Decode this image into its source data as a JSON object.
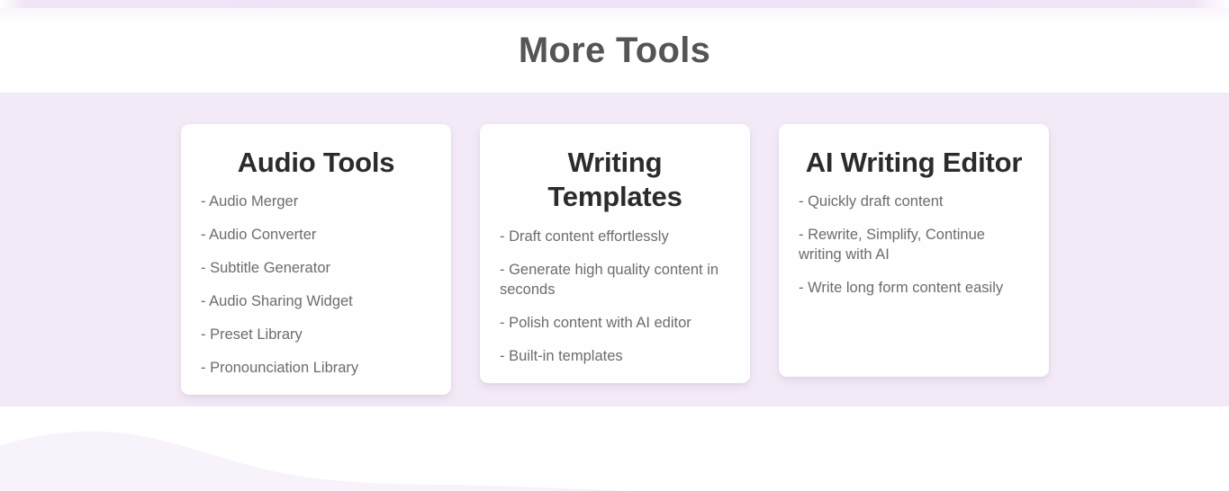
{
  "section": {
    "title": "More Tools"
  },
  "colors": {
    "band_background": "#f3eaf7",
    "card_background": "#fefefe",
    "page_title": "#555558",
    "card_title": "#2b2b2e",
    "list_text": "#6c6c72",
    "top_strip": "#efe2f6",
    "wave": "#f8f2fb"
  },
  "cards": [
    {
      "title": "Audio Tools",
      "items": [
        "- Audio Merger",
        "- Audio Converter",
        "- Subtitle Generator",
        "- Audio Sharing Widget",
        "- Preset Library",
        "- Pronounciation Library"
      ]
    },
    {
      "title": "Writing Templates",
      "items": [
        "- Draft content effortlessly",
        "- Generate high quality content in seconds",
        "- Polish content with AI editor",
        "- Built-in templates"
      ]
    },
    {
      "title": "AI Writing Editor",
      "items": [
        "- Quickly draft content",
        "- Rewrite, Simplify, Continue writing with AI",
        "- Write long form content easily"
      ]
    }
  ]
}
